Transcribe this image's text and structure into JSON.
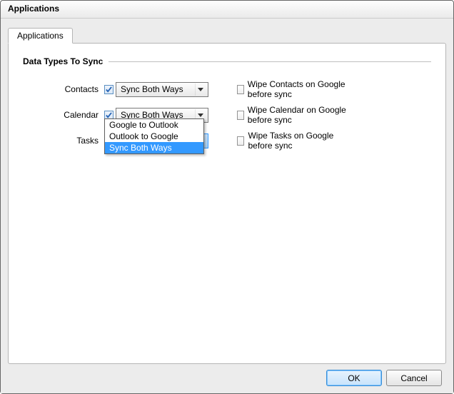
{
  "window": {
    "title": "Applications"
  },
  "tabs": [
    "Applications"
  ],
  "section": {
    "title": "Data Types To Sync"
  },
  "rows": {
    "contacts": {
      "label": "Contacts",
      "checked": true,
      "direction": "Sync Both Ways",
      "wipe_label": "Wipe Contacts on Google before sync",
      "wipe_checked": false
    },
    "calendar": {
      "label": "Calendar",
      "checked": true,
      "direction": "Sync Both Ways",
      "wipe_label": "Wipe Calendar on Google before sync",
      "wipe_checked": false
    },
    "tasks": {
      "label": "Tasks",
      "checked": true,
      "direction": "Sync Both Ways",
      "wipe_label": "Wipe Tasks on Google before sync",
      "wipe_checked": false,
      "dropdown_open": true
    }
  },
  "direction_options": [
    "Google to Outlook",
    "Outlook to Google",
    "Sync Both Ways"
  ],
  "direction_selected": "Sync Both Ways",
  "buttons": {
    "ok": "OK",
    "cancel": "Cancel"
  }
}
